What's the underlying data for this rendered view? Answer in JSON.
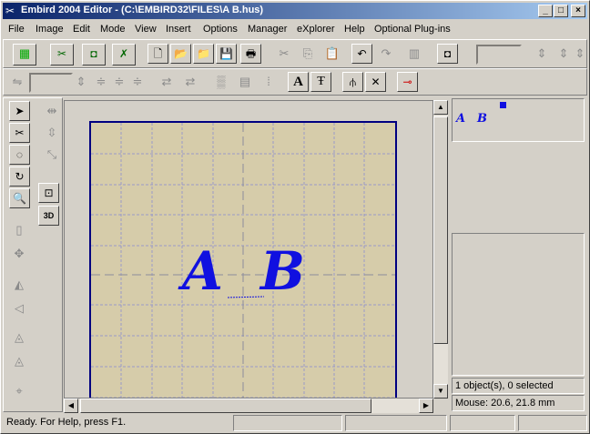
{
  "window": {
    "title": "Embird 2004 Editor - (C:\\EMBIRD32\\FILES\\A  B.hus)"
  },
  "menu": [
    "File",
    "Image",
    "Edit",
    "Mode",
    "View",
    "Insert",
    "Options",
    "Manager",
    "eXplorer",
    "Help",
    "Optional Plug-ins"
  ],
  "canvas": {
    "letters": [
      "A",
      "B"
    ],
    "thread_color": "#1010e0",
    "hoop_fabric_color": "#d6ccaa",
    "hoop_border_color": "#000080"
  },
  "preview": {
    "letters": [
      "A",
      "B"
    ]
  },
  "tools": {
    "view_3d_label": "3D"
  },
  "info": {
    "objects": "1 object(s), 0 selected",
    "mouse": "Mouse: 20.6, 21.8 mm"
  },
  "status": {
    "text": "Ready. For Help, press F1."
  }
}
